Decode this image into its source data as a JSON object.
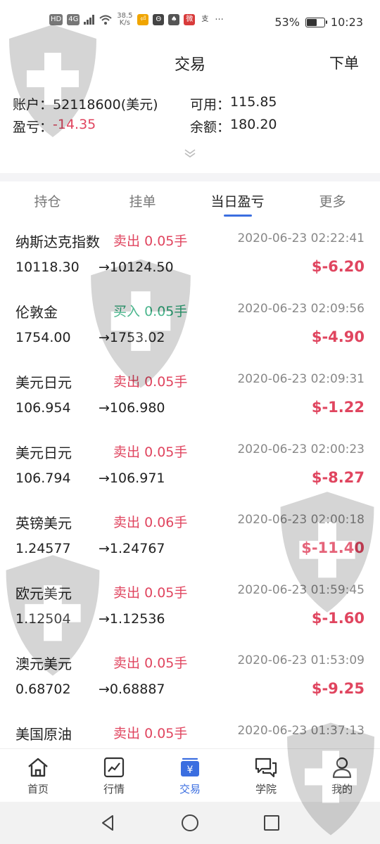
{
  "status_bar": {
    "icons": [
      "HD",
      "4G"
    ],
    "speed": "38.5 K/s",
    "app_icons": [
      "⏎",
      "Θ",
      "♠",
      "微",
      "支"
    ],
    "more": "···",
    "battery": "53%",
    "battery_level": 0.53,
    "time": "10:23"
  },
  "header": {
    "title": "交易",
    "action": "下单"
  },
  "account": {
    "account_label": "账户：",
    "account_value": "52118600(美元)",
    "available_label": "可用：",
    "available_value": "115.85",
    "pnl_label": "盈亏：",
    "pnl_value": "-14.35",
    "balance_label": "余额：",
    "balance_value": "180.20"
  },
  "tabs": [
    {
      "label": "持仓"
    },
    {
      "label": "挂单"
    },
    {
      "label": "当日盈亏"
    },
    {
      "label": "更多"
    }
  ],
  "trades": [
    {
      "name": "纳斯达克指数",
      "direction": "卖出",
      "lots": "0.05手",
      "time": "2020-06-23 02:22:41",
      "open": "10118.30",
      "close": "→10124.50",
      "pnl": "$-6.20"
    },
    {
      "name": "伦敦金",
      "direction": "买入",
      "lots": "0.05手",
      "time": "2020-06-23 02:09:56",
      "open": "1754.00",
      "close": "→1753.02",
      "pnl": "$-4.90"
    },
    {
      "name": "美元日元",
      "direction": "卖出",
      "lots": "0.05手",
      "time": "2020-06-23 02:09:31",
      "open": "106.954",
      "close": "→106.980",
      "pnl": "$-1.22"
    },
    {
      "name": "美元日元",
      "direction": "卖出",
      "lots": "0.05手",
      "time": "2020-06-23 02:00:23",
      "open": "106.794",
      "close": "→106.971",
      "pnl": "$-8.27"
    },
    {
      "name": "英镑美元",
      "direction": "卖出",
      "lots": "0.06手",
      "time": "2020-06-23 02:00:18",
      "open": "1.24577",
      "close": "→1.24767",
      "pnl": "$-11.40"
    },
    {
      "name": "欧元美元",
      "direction": "卖出",
      "lots": "0.05手",
      "time": "2020-06-23 01:59:45",
      "open": "1.12504",
      "close": "→1.12536",
      "pnl": "$-1.60"
    },
    {
      "name": "澳元美元",
      "direction": "卖出",
      "lots": "0.05手",
      "time": "2020-06-23 01:53:09",
      "open": "0.68702",
      "close": "→0.68887",
      "pnl": "$-9.25"
    },
    {
      "name": "美国原油",
      "direction": "卖出",
      "lots": "0.05手",
      "time": "2020-06-23 01:37:13",
      "open": "",
      "close": "",
      "pnl": ""
    }
  ],
  "bottom_nav": [
    {
      "label": "首页",
      "icon": "home-icon"
    },
    {
      "label": "行情",
      "icon": "chart-icon"
    },
    {
      "label": "交易",
      "icon": "trade-icon"
    },
    {
      "label": "学院",
      "icon": "chat-icon"
    },
    {
      "label": "我的",
      "icon": "user-icon"
    }
  ],
  "colors": {
    "loss": "#e0455f",
    "buy": "#2aa878",
    "accent": "#3b6ee0"
  }
}
